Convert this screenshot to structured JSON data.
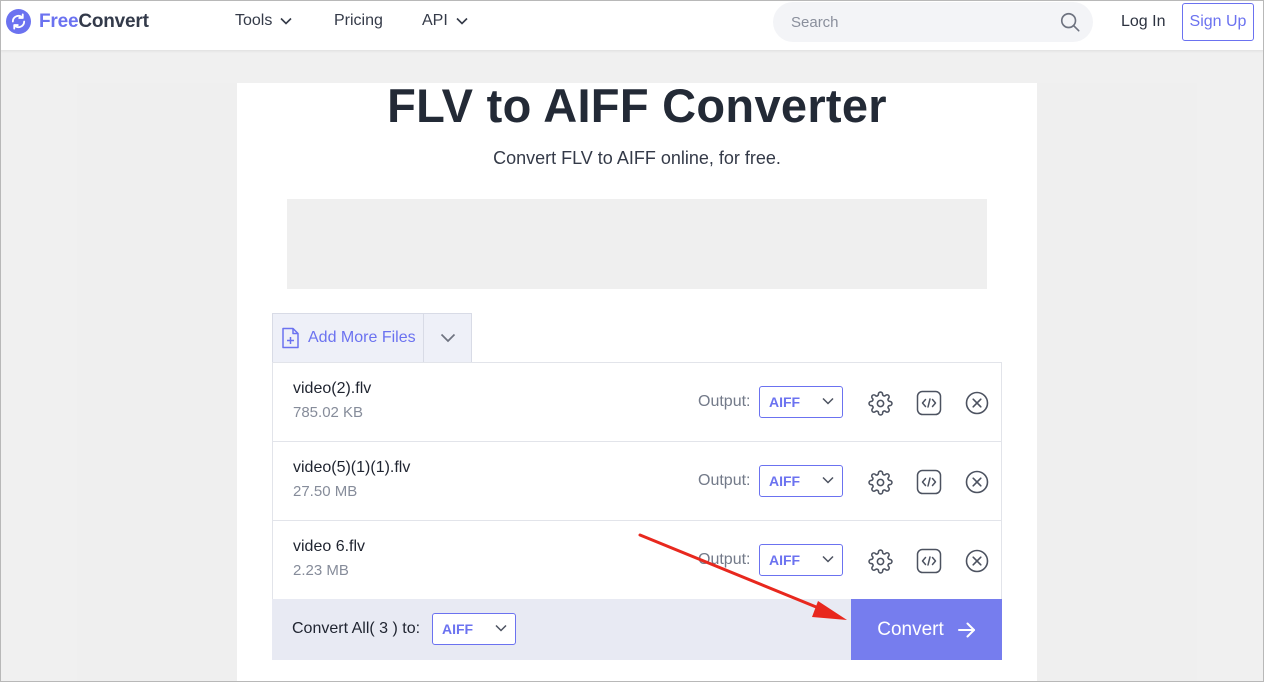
{
  "header": {
    "logo_free": "Free",
    "logo_convert": "Convert",
    "nav": [
      {
        "label": "Tools",
        "has_dropdown": true
      },
      {
        "label": "Pricing",
        "has_dropdown": false
      },
      {
        "label": "API",
        "has_dropdown": true
      }
    ],
    "search_placeholder": "Search",
    "login_label": "Log In",
    "signup_label": "Sign Up"
  },
  "main": {
    "title": "FLV to AIFF Converter",
    "subtitle": "Convert FLV to AIFF online, for free."
  },
  "uploader": {
    "add_files_label": "Add More Files",
    "files": [
      {
        "name": "video(2).flv",
        "size": "785.02 KB",
        "output_label": "Output:",
        "format": "AIFF"
      },
      {
        "name": "video(5)(1)(1).flv",
        "size": "27.50 MB",
        "output_label": "Output:",
        "format": "AIFF"
      },
      {
        "name": "video 6.flv",
        "size": "2.23 MB",
        "output_label": "Output:",
        "format": "AIFF"
      }
    ],
    "convert_all_label": "Convert All( 3 ) to:",
    "convert_all_format": "AIFF",
    "convert_label": "Convert"
  },
  "colors": {
    "accent": "#6b72f0",
    "convert_button": "#767dee",
    "annotation_arrow": "#e8281e"
  },
  "icons": {
    "row_actions": [
      "settings-gear-icon",
      "embed-code-icon",
      "remove-circle-icon"
    ],
    "annotation": "red-arrow-pointing-to-convert"
  }
}
